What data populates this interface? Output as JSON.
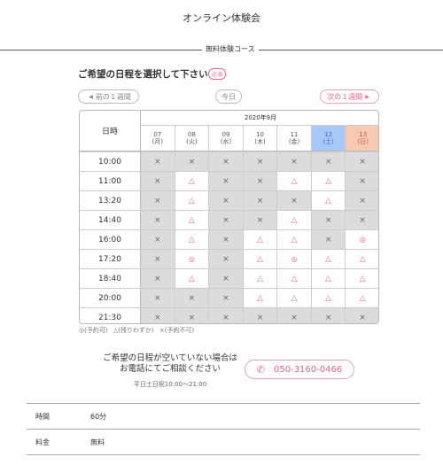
{
  "header": {
    "title": "オンライン体験会"
  },
  "section": {
    "label": "無料体験コース"
  },
  "schedule": {
    "heading": "ご希望の日程を選択して下さい",
    "required_badge": "必須",
    "nav": {
      "prev": "前の１週間",
      "today": "今日",
      "next": "次の１週間"
    },
    "corner_label": "日時",
    "month_label": "2020年9月",
    "days": [
      {
        "date": "07",
        "weekday": "(月)",
        "kind": "weekday"
      },
      {
        "date": "08",
        "weekday": "(火)",
        "kind": "weekday"
      },
      {
        "date": "09",
        "weekday": "(水)",
        "kind": "weekday"
      },
      {
        "date": "10",
        "weekday": "(木)",
        "kind": "weekday"
      },
      {
        "date": "11",
        "weekday": "(金)",
        "kind": "weekday"
      },
      {
        "date": "12",
        "weekday": "(土)",
        "kind": "sat"
      },
      {
        "date": "13",
        "weekday": "(日)",
        "kind": "sun"
      }
    ],
    "times": [
      "10:00",
      "11:00",
      "13:20",
      "14:40",
      "16:00",
      "17:20",
      "18:40",
      "20:00",
      "21:30"
    ],
    "slots": [
      [
        "x",
        "x",
        "x",
        "x",
        "x",
        "x",
        "x"
      ],
      [
        "x",
        "few",
        "x",
        "x",
        "few",
        "few",
        "x"
      ],
      [
        "x",
        "few",
        "x",
        "x",
        "x",
        "few",
        "x"
      ],
      [
        "x",
        "few",
        "x",
        "x",
        "few",
        "x",
        "x"
      ],
      [
        "x",
        "few",
        "x",
        "few",
        "few",
        "x",
        "ok"
      ],
      [
        "x",
        "ok",
        "x",
        "few",
        "ok",
        "few",
        "few"
      ],
      [
        "x",
        "few",
        "x",
        "few",
        "few",
        "few",
        "few"
      ],
      [
        "x",
        "x",
        "x",
        "few",
        "few",
        "few",
        "few"
      ],
      [
        "x",
        "x",
        "x",
        "x",
        "x",
        "x",
        "x"
      ]
    ],
    "symbols": {
      "ok": "◎",
      "few": "△",
      "x": "×"
    },
    "legend": {
      "ok": "◎(予約可)",
      "few": "△(残りわずか)",
      "x": "×(予約不可)"
    }
  },
  "contact": {
    "line1": "ご希望の日程が空いていない場合は",
    "line2": "お電話にてご相談ください",
    "hours": "平日土日祝10:00〜21:00",
    "phone": "050-3160-0466"
  },
  "info": [
    {
      "label": "時間",
      "value": "60分"
    },
    {
      "label": "料金",
      "value": "無料"
    }
  ],
  "colors": {
    "accent": "#e8668a",
    "saturday": "#a8c8f8",
    "sunday": "#f6c9b0",
    "unavailable": "#dcdcdc"
  }
}
